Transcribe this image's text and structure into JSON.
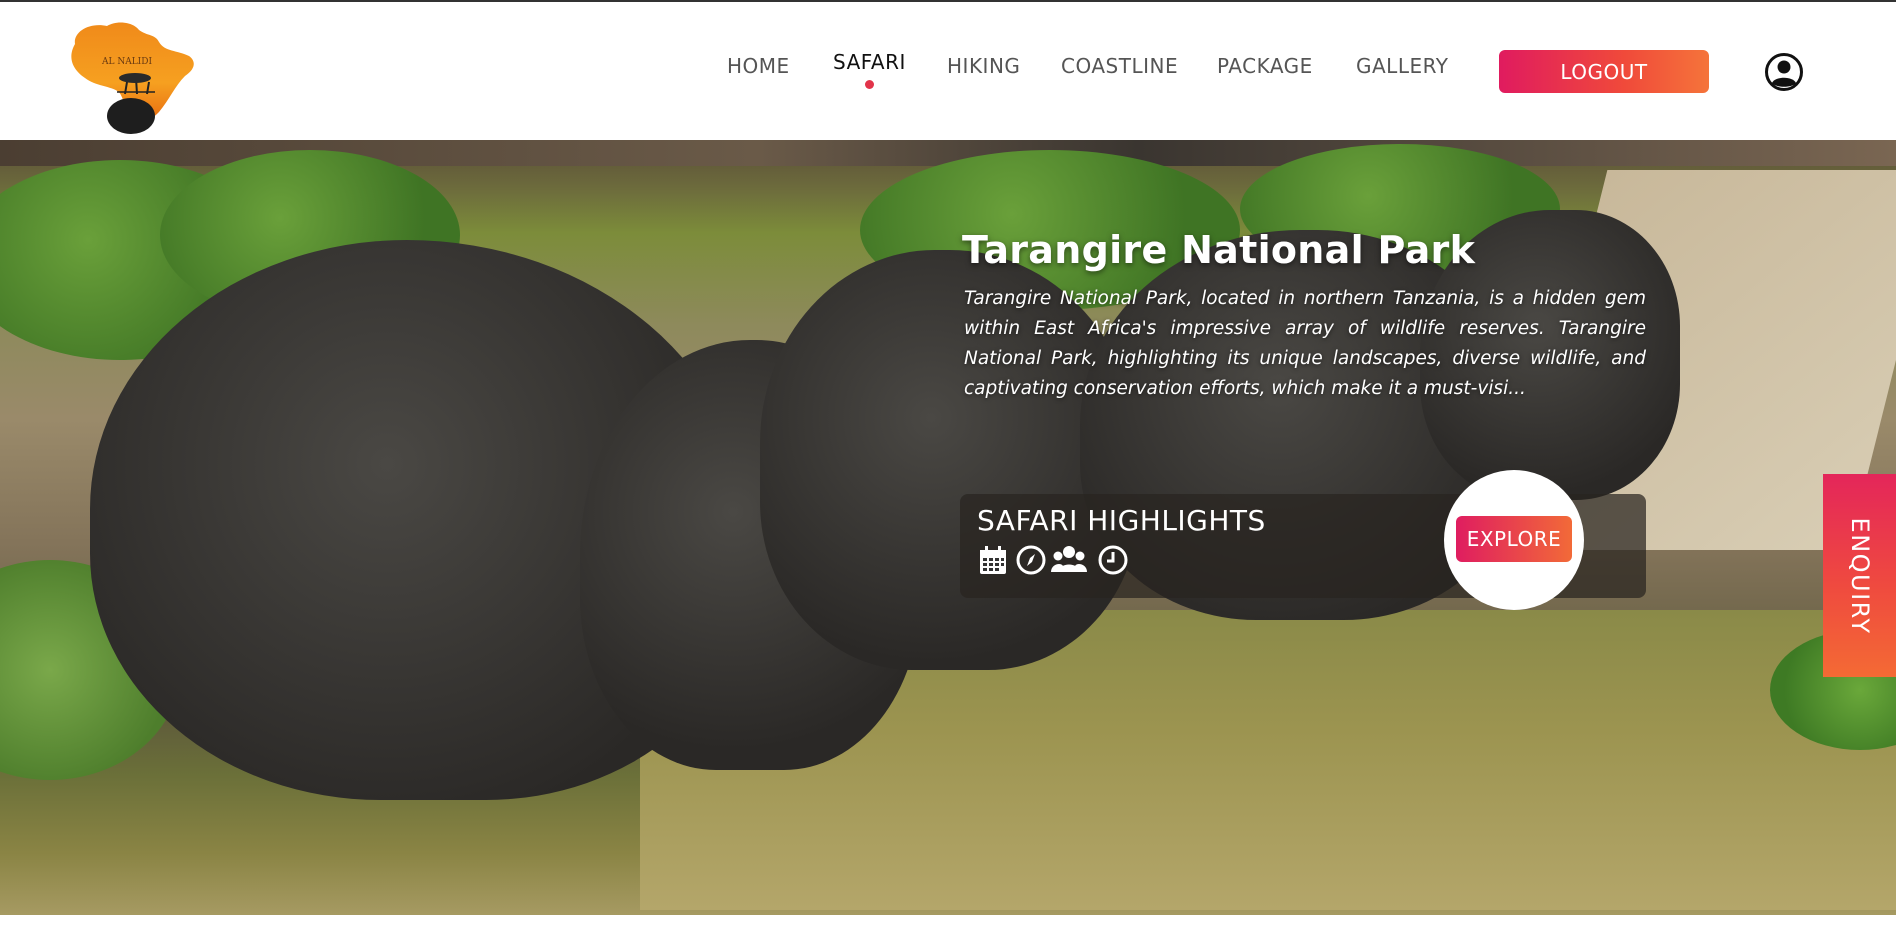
{
  "header": {
    "logo_alt": "AL NALIDI Safaris",
    "nav": [
      {
        "label": "HOME",
        "active": false
      },
      {
        "label": "SAFARI",
        "active": true
      },
      {
        "label": "HIKING",
        "active": false
      },
      {
        "label": "COASTLINE",
        "active": false
      },
      {
        "label": "PACKAGE",
        "active": false
      },
      {
        "label": "GALLERY",
        "active": false
      }
    ],
    "logout_label": "LOGOUT",
    "user_icon": "user-circle-icon"
  },
  "hero": {
    "title": "Tarangire National Park",
    "description": "Tarangire National Park, located in northern Tanzania, is a hidden gem within East Africa's impressive array of wildlife reserves. Tarangire National Park, highlighting its unique landscapes, diverse wildlife, and captivating conservation efforts, which make it a must-visi...",
    "highlights": {
      "title": "SAFARI HIGHLIGHTS",
      "icons": [
        "calendar-icon",
        "compass-icon",
        "group-icon",
        "clock-icon"
      ]
    },
    "explore_label": "EXPLORE"
  },
  "enquiry_label": "ENQUIRY",
  "colors": {
    "accent_start": "#e01b5f",
    "accent_end": "#f5743a",
    "active_dot": "#e2344a"
  }
}
